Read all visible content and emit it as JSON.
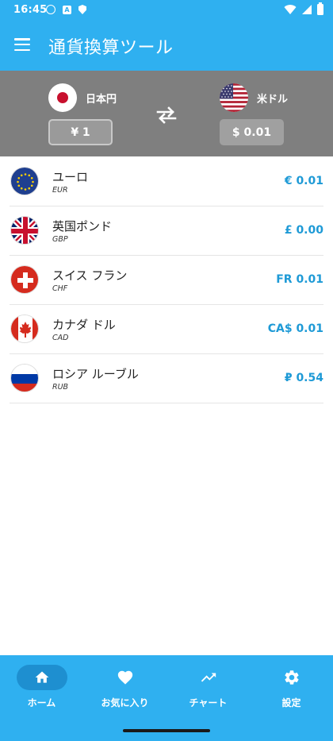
{
  "status_bar": {
    "time": "16:45"
  },
  "app_bar": {
    "title": "通貨換算ツール"
  },
  "converter": {
    "from": {
      "name": "日本円",
      "amount": "¥ 1"
    },
    "to": {
      "name": "米ドル",
      "amount": "$ 0.01"
    }
  },
  "currencies": [
    {
      "name": "ユーロ",
      "code": "EUR",
      "value": "€ 0.01",
      "flag_icon": "eu-flag-icon"
    },
    {
      "name": "英国ポンド",
      "code": "GBP",
      "value": "£ 0.00",
      "flag_icon": "uk-flag-icon"
    },
    {
      "name": "スイス フラン",
      "code": "CHF",
      "value": "FR 0.01",
      "flag_icon": "swiss-flag-icon"
    },
    {
      "name": "カナダ ドル",
      "code": "CAD",
      "value": "CA$ 0.01",
      "flag_icon": "canada-flag-icon"
    },
    {
      "name": "ロシア ルーブル",
      "code": "RUB",
      "value": "₽ 0.54",
      "flag_icon": "russia-flag-icon"
    }
  ],
  "bottom_nav": [
    {
      "label": "ホーム",
      "icon": "home-icon",
      "active": true
    },
    {
      "label": "お気に入り",
      "icon": "heart-icon",
      "active": false
    },
    {
      "label": "チャート",
      "icon": "trending-up-icon",
      "active": false
    },
    {
      "label": "設定",
      "icon": "gear-icon",
      "active": false
    }
  ],
  "colors": {
    "primary": "#2FB0F0",
    "panel": "#7F7F7F",
    "value_text": "#1E9AD6",
    "active_pill": "#1E8FD0"
  }
}
